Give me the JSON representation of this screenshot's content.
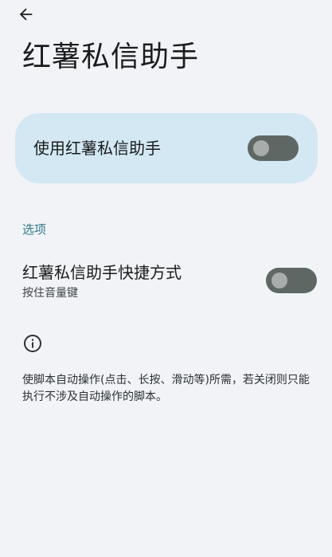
{
  "app_bar": {
    "back_icon": "arrow-left-icon"
  },
  "page": {
    "title": "红薯私信助手"
  },
  "main_switch": {
    "label": "使用红薯私信助手",
    "enabled": false,
    "colors": {
      "card": "#d3e8f2",
      "track": "#5f6765",
      "thumb": "#a8adac"
    }
  },
  "options": {
    "header": "选项",
    "header_color": "#2e7a8a",
    "shortcut": {
      "title": "红薯私信助手快捷方式",
      "summary": "按住音量键",
      "enabled": false
    }
  },
  "footer": {
    "icon": "info-icon",
    "text": "使脚本自动操作(点击、长按、滑动等)所需，若关闭则只能执行不涉及自动操作的脚本。"
  }
}
